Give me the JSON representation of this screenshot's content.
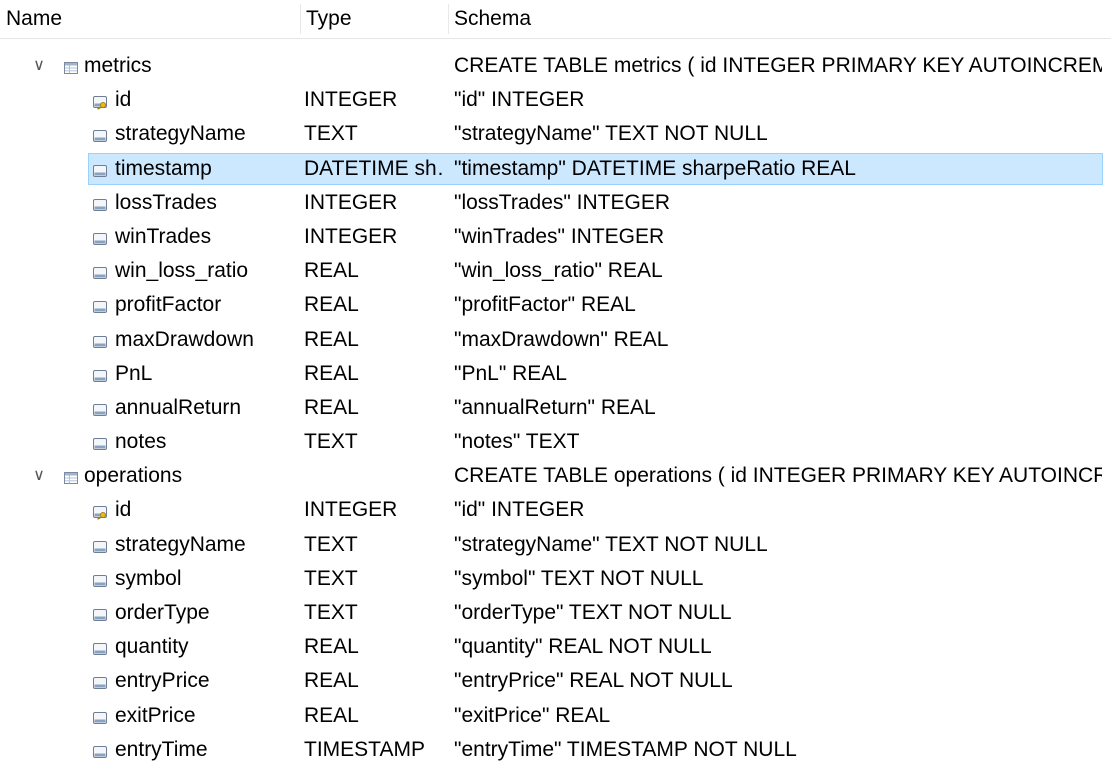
{
  "header": {
    "name": "Name",
    "type": "Type",
    "schema": "Schema"
  },
  "tables": [
    {
      "name": "metrics",
      "schema": "CREATE TABLE metrics ( id INTEGER PRIMARY KEY AUTOINCREMENT, -- I",
      "expander_icon": "chevron-down-icon",
      "icon": "table-icon",
      "fields": [
        {
          "name": "id",
          "type": "INTEGER",
          "schema": "\"id\" INTEGER",
          "icon": "primary-key-field-icon"
        },
        {
          "name": "strategyName",
          "type": "TEXT",
          "schema": "\"strategyName\" TEXT NOT NULL",
          "icon": "field-icon"
        },
        {
          "name": "timestamp",
          "type": "DATETIME sh…",
          "schema": "\"timestamp\" DATETIME sharpeRatio REAL",
          "icon": "field-icon",
          "selected": true
        },
        {
          "name": "lossTrades",
          "type": "INTEGER",
          "schema": "\"lossTrades\" INTEGER",
          "icon": "field-icon"
        },
        {
          "name": "winTrades",
          "type": "INTEGER",
          "schema": "\"winTrades\" INTEGER",
          "icon": "field-icon"
        },
        {
          "name": "win_loss_ratio",
          "type": "REAL",
          "schema": "\"win_loss_ratio\" REAL",
          "icon": "field-icon"
        },
        {
          "name": "profitFactor",
          "type": "REAL",
          "schema": "\"profitFactor\" REAL",
          "icon": "field-icon"
        },
        {
          "name": "maxDrawdown",
          "type": "REAL",
          "schema": "\"maxDrawdown\" REAL",
          "icon": "field-icon"
        },
        {
          "name": "PnL",
          "type": "REAL",
          "schema": "\"PnL\" REAL",
          "icon": "field-icon"
        },
        {
          "name": "annualReturn",
          "type": "REAL",
          "schema": "\"annualReturn\" REAL",
          "icon": "field-icon"
        },
        {
          "name": "notes",
          "type": "TEXT",
          "schema": "\"notes\" TEXT",
          "icon": "field-icon"
        }
      ]
    },
    {
      "name": "operations",
      "schema": "CREATE TABLE operations ( id INTEGER PRIMARY KEY AUTOINCREMENT,",
      "expander_icon": "chevron-down-icon",
      "icon": "table-icon",
      "fields": [
        {
          "name": "id",
          "type": "INTEGER",
          "schema": "\"id\" INTEGER",
          "icon": "primary-key-field-icon"
        },
        {
          "name": "strategyName",
          "type": "TEXT",
          "schema": "\"strategyName\" TEXT NOT NULL",
          "icon": "field-icon"
        },
        {
          "name": "symbol",
          "type": "TEXT",
          "schema": "\"symbol\" TEXT NOT NULL",
          "icon": "field-icon"
        },
        {
          "name": "orderType",
          "type": "TEXT",
          "schema": "\"orderType\" TEXT NOT NULL",
          "icon": "field-icon"
        },
        {
          "name": "quantity",
          "type": "REAL",
          "schema": "\"quantity\" REAL NOT NULL",
          "icon": "field-icon"
        },
        {
          "name": "entryPrice",
          "type": "REAL",
          "schema": "\"entryPrice\" REAL NOT NULL",
          "icon": "field-icon"
        },
        {
          "name": "exitPrice",
          "type": "REAL",
          "schema": "\"exitPrice\" REAL",
          "icon": "field-icon"
        },
        {
          "name": "entryTime",
          "type": "TIMESTAMP",
          "schema": "\"entryTime\" TIMESTAMP NOT NULL",
          "icon": "field-icon"
        }
      ]
    }
  ],
  "colors": {
    "selection_bg": "#cce8ff",
    "selection_border": "#99d1ff"
  }
}
